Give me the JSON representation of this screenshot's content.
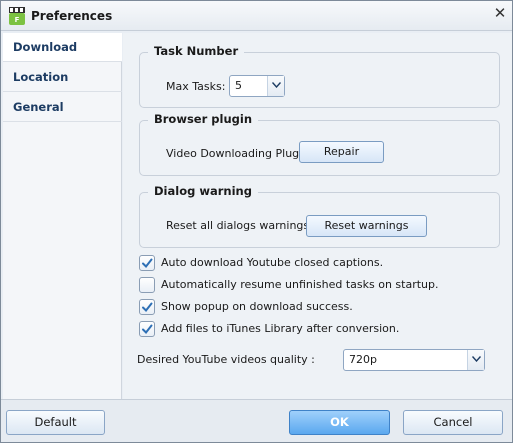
{
  "window": {
    "title": "Preferences",
    "app_icon": "free-app-icon",
    "close_icon": "close-icon"
  },
  "sidebar": {
    "items": [
      {
        "label": "Download",
        "active": true
      },
      {
        "label": "Location",
        "active": false
      },
      {
        "label": "General",
        "active": false
      }
    ]
  },
  "task_number": {
    "title": "Task Number",
    "max_tasks_label": "Max Tasks:",
    "max_tasks_value": "5"
  },
  "browser_plugin": {
    "title": "Browser plugin",
    "plugin_label": "Video Downloading Plugin:",
    "repair_label": "Repair"
  },
  "dialog_warning": {
    "title": "Dialog warning",
    "reset_label": "Reset all dialogs warnings :",
    "reset_button": "Reset warnings"
  },
  "options": [
    {
      "label": "Auto download Youtube closed captions.",
      "checked": true
    },
    {
      "label": "Automatically resume unfinished  tasks on startup.",
      "checked": false
    },
    {
      "label": "Show popup on download success.",
      "checked": true
    },
    {
      "label": "Add files to iTunes Library after conversion.",
      "checked": true
    }
  ],
  "quality": {
    "label": "Desired YouTube videos quality :",
    "value": "720p"
  },
  "footer": {
    "default_label": "Default",
    "ok_label": "OK",
    "cancel_label": "Cancel"
  },
  "colors": {
    "accent": "#5aa8ef",
    "check": "#2d6fb5"
  }
}
